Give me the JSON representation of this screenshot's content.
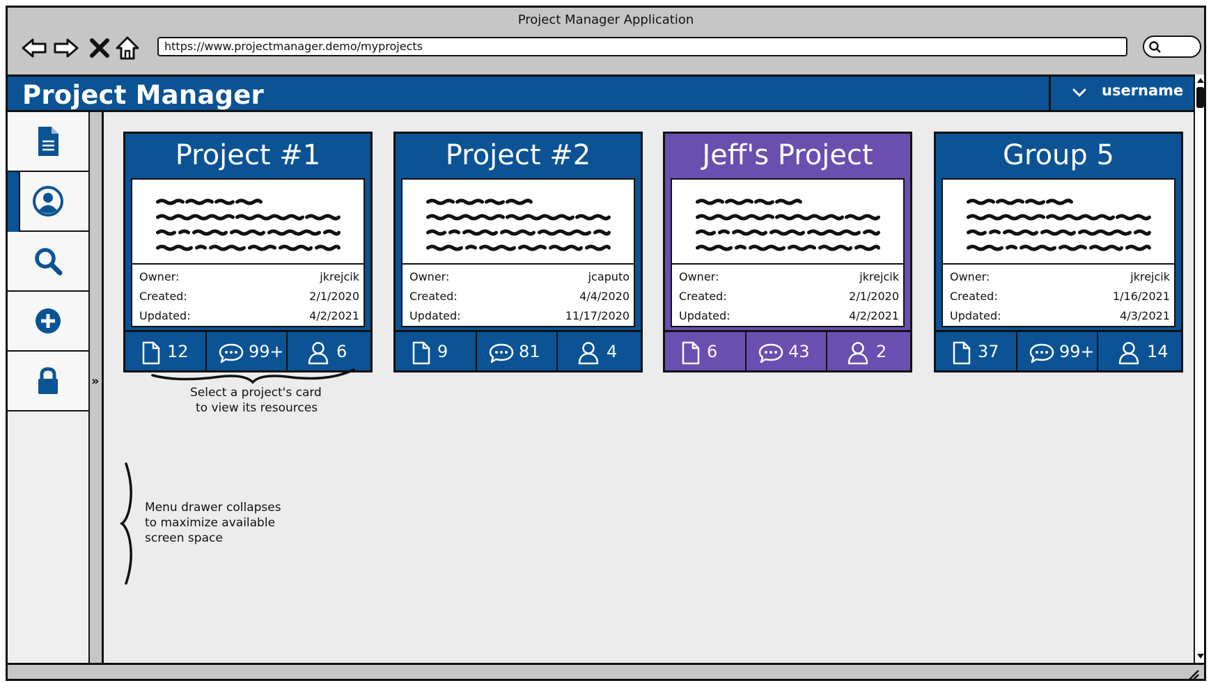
{
  "window": {
    "title": "Project Manager Application"
  },
  "browser": {
    "url": "https://www.projectmanager.demo/myprojects",
    "nav_icons": [
      "back-arrow-icon",
      "forward-arrow-icon",
      "stop-icon",
      "home-icon"
    ]
  },
  "app": {
    "title": "Project Manager",
    "user_label": "username"
  },
  "sidebar": {
    "items": [
      {
        "name": "documents",
        "icon": "document-icon"
      },
      {
        "name": "profile",
        "icon": "user-circle-icon",
        "active": true
      },
      {
        "name": "search",
        "icon": "search-icon"
      },
      {
        "name": "add",
        "icon": "plus-circle-icon"
      },
      {
        "name": "lock",
        "icon": "lock-icon"
      }
    ],
    "toggle_glyph": "»"
  },
  "cards": [
    {
      "title": "Project #1",
      "color": "#0b5394",
      "owner_label": "Owner:",
      "owner": "jkrejcik",
      "created_label": "Created:",
      "created": "2/1/2020",
      "updated_label": "Updated:",
      "updated": "4/2/2021",
      "files": "12",
      "comments": "99+",
      "members": "6"
    },
    {
      "title": "Project #2",
      "color": "#0b5394",
      "owner_label": "Owner:",
      "owner": "jcaputo",
      "created_label": "Created:",
      "created": "4/4/2020",
      "updated_label": "Updated:",
      "updated": "11/17/2020",
      "files": "9",
      "comments": "81",
      "members": "4"
    },
    {
      "title": "Jeff's Project",
      "color": "#6a4eb0",
      "owner_label": "Owner:",
      "owner": "jkrejcik",
      "created_label": "Created:",
      "created": "2/1/2020",
      "updated_label": "Updated:",
      "updated": "4/2/2021",
      "files": "6",
      "comments": "43",
      "members": "2"
    },
    {
      "title": "Group 5",
      "color": "#0b5394",
      "owner_label": "Owner:",
      "owner": "jkrejcik",
      "created_label": "Created:",
      "created": "1/16/2021",
      "updated_label": "Updated:",
      "updated": "4/3/2021",
      "files": "37",
      "comments": "99+",
      "members": "14"
    }
  ],
  "annotations": {
    "card_hint_line1": "Select a project's card",
    "card_hint_line2": "to view its resources",
    "drawer_hint_line1": "Menu drawer collapses",
    "drawer_hint_line2": "to maximize available",
    "drawer_hint_line3": "screen space"
  }
}
